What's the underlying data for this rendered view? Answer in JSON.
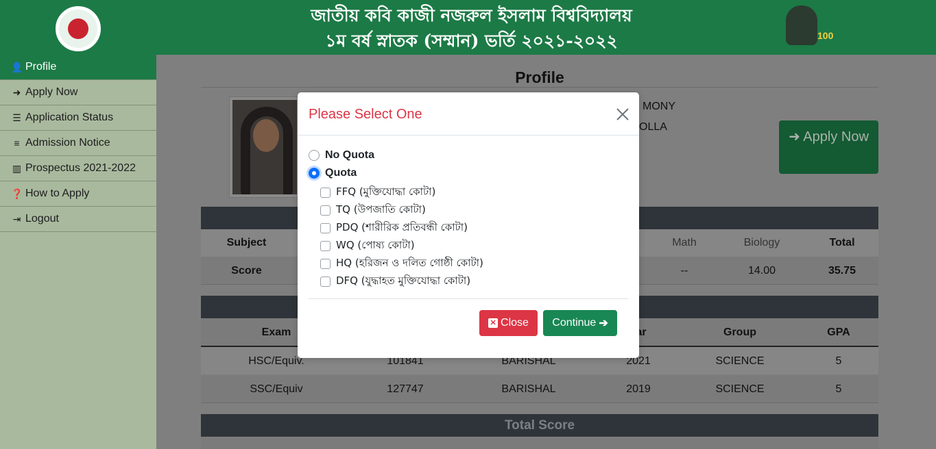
{
  "header": {
    "title_line1": "জাতীয় কবি কাজী নজরুল ইসলাম বিশ্ববিদ্যালয়",
    "title_line2": "১ম বর্ষ স্নাতক (সম্মান) ভর্তি ২০২১-২০২২",
    "right_logo_text": "100"
  },
  "sidebar": {
    "items": [
      {
        "label": "Profile",
        "icon": "user-icon",
        "active": true
      },
      {
        "label": "Apply Now",
        "icon": "sign-in-icon",
        "active": false
      },
      {
        "label": "Application Status",
        "icon": "list-check-icon",
        "active": false
      },
      {
        "label": "Admission Notice",
        "icon": "bars-icon",
        "active": false
      },
      {
        "label": "Prospectus 2021-2022",
        "icon": "bar-chart-icon",
        "active": false
      },
      {
        "label": "How to Apply",
        "icon": "question-circle-icon",
        "active": false
      },
      {
        "label": "Logout",
        "icon": "sign-out-icon",
        "active": false
      }
    ]
  },
  "profile": {
    "title": "Profile",
    "name_fragment": "MONY",
    "parent_fragment": "OLLA",
    "apply_button": "Apply Now"
  },
  "score_table": {
    "headers": {
      "subject": "Subject",
      "math": "Math",
      "biology": "Biology",
      "total": "Total"
    },
    "row_label": "Score",
    "math": "--",
    "biology": "14.00",
    "total": "35.75"
  },
  "exam_table": {
    "headers": {
      "exam": "Exam",
      "year": "ar",
      "group": "Group",
      "gpa": "GPA"
    },
    "rows": [
      {
        "exam": "HSC/Equiv.",
        "roll": "101841",
        "board": "BARISHAL",
        "year": "2021",
        "group": "SCIENCE",
        "gpa": "5"
      },
      {
        "exam": "SSC/Equiv",
        "roll": "127747",
        "board": "BARISHAL",
        "year": "2019",
        "group": "SCIENCE",
        "gpa": "5"
      }
    ]
  },
  "total_score": {
    "title": "Total Score"
  },
  "modal": {
    "title": "Please Select One",
    "options": {
      "no_quota": "No Quota",
      "quota": "Quota"
    },
    "selected": "quota",
    "quota_types": [
      "FFQ (মুক্তিযোদ্ধা কোটা)",
      "TQ (উপজাতি কোটা)",
      "PDQ (শারীরিক প্রতিবন্ধী কোটা)",
      "WQ (পোষ্য কোটা)",
      "HQ (হরিজন ও দলিত গোষ্ঠী কোটা)",
      "DFQ (যুদ্ধাহত মুক্তিযোদ্ধা কোটা)"
    ],
    "close_label": "Close",
    "continue_label": "Continue"
  },
  "colors": {
    "brand_green": "#1c7a46",
    "danger": "#dc3545",
    "success": "#198754",
    "primary": "#0d6efd"
  }
}
